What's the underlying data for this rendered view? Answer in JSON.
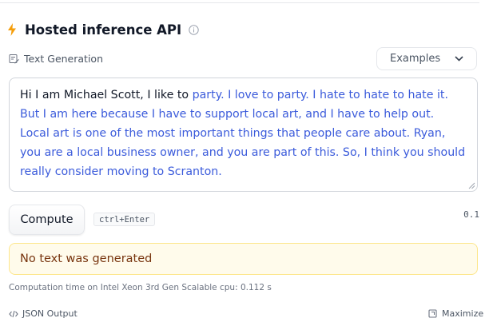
{
  "header": {
    "title": "Hosted inference API",
    "accent": "#f59e0b"
  },
  "task": {
    "label": "Text Generation",
    "icon": "text-generation-icon"
  },
  "examples": {
    "label": "Examples"
  },
  "textbox": {
    "prompt_text": "Hi I am Michael Scott, I like to ",
    "generated_text": "party. I love to party. I hate to hate to hate it. But I am here because I have to support local art, and I have to help out. Local art is one of the most important things that people care about. Ryan, you are a local business owner, and you are part of this. So, I think you should really consider moving to Scranton.",
    "generated_color": "#3b5bdb"
  },
  "actions": {
    "compute_label": "Compute",
    "shortcut": "ctrl+Enter",
    "version": "0.1"
  },
  "result": {
    "message": "No text was generated",
    "computation_time": "Computation time on Intel Xeon 3rd Gen Scalable cpu: 0.112 s"
  },
  "footer": {
    "json_output_label": "JSON Output",
    "maximize_label": "Maximize"
  }
}
